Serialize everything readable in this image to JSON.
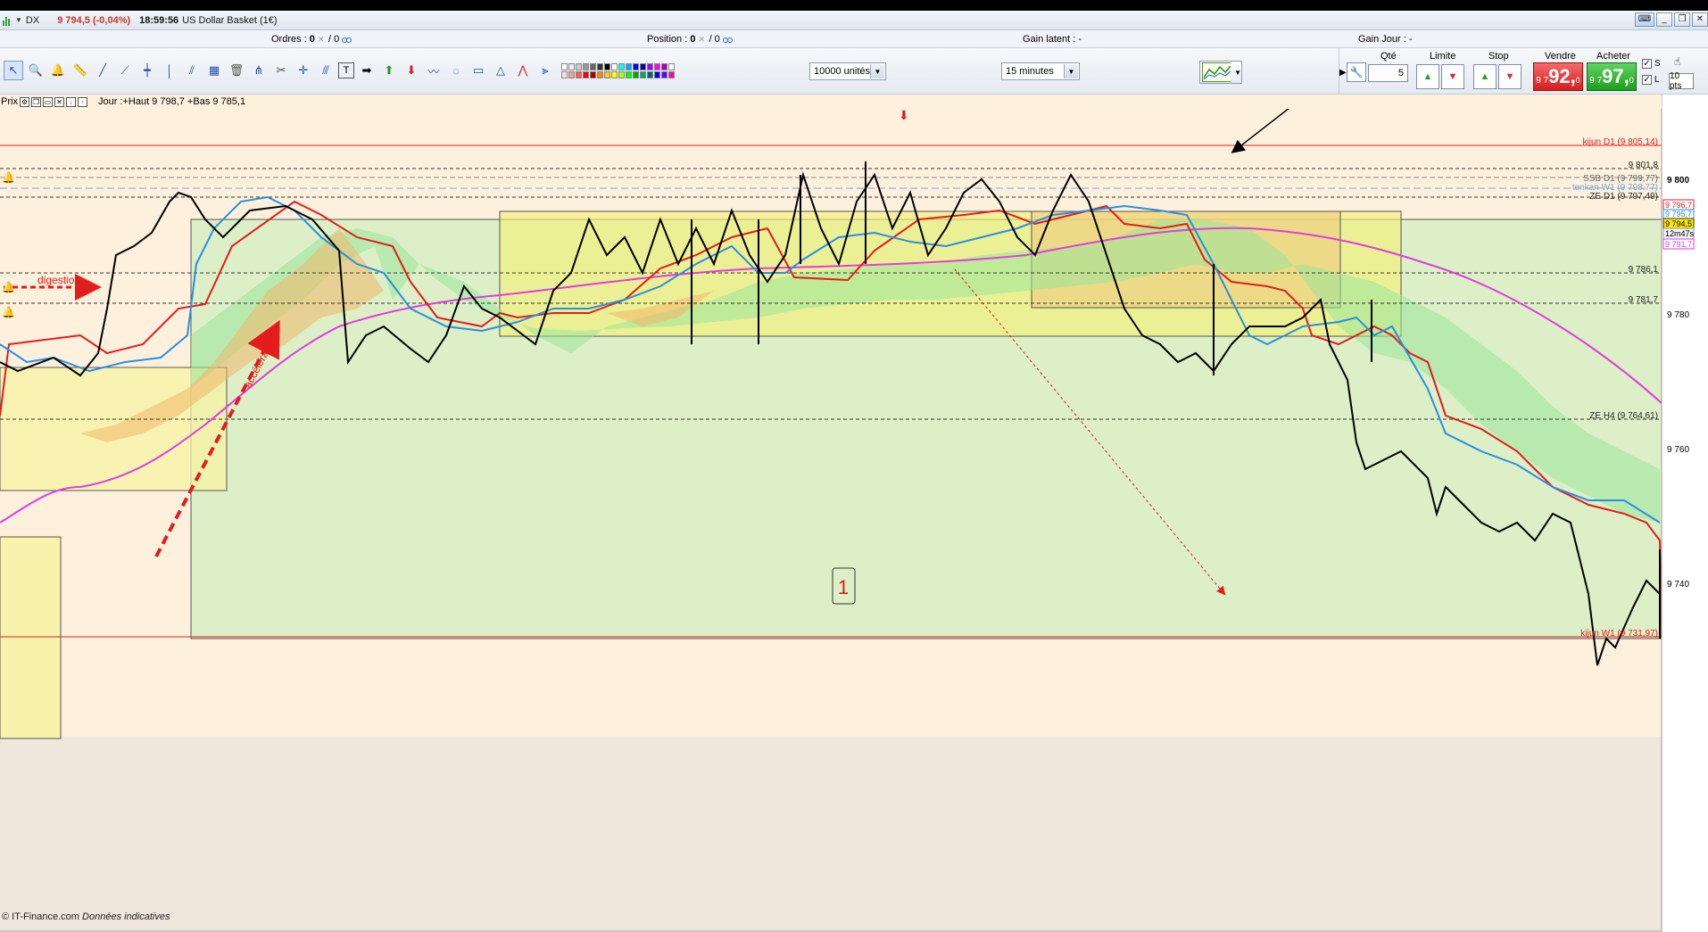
{
  "title_bar": {
    "symbol": "DX",
    "price_change": "9 794,5 (-0,04%)",
    "time": "18:59:56",
    "description": "US Dollar Basket (1€)"
  },
  "info_bar": {
    "ordres_label": "Ordres :",
    "ordres_value": "0",
    "ordres_slash": "/ 0",
    "position_label": "Position :",
    "position_value": "0",
    "position_slash": "/ 0",
    "gain_latent": "Gain latent : -",
    "gain_jour": "Gain Jour : -"
  },
  "toolbar": {
    "units_select": "10000 unités",
    "timeframe_select": "15 minutes",
    "tools": [
      "pointer-icon",
      "zoom-icon",
      "alarm-icon",
      "ruler-icon",
      "line-icon",
      "ray-icon",
      "horizontal-line-icon",
      "vertical-line-icon",
      "fibonacci-icon",
      "channel-icon",
      "trash-icon",
      "pitchfork-icon",
      "tools-icon",
      "crosshair-icon",
      "parallel-icon",
      "text-icon",
      "arrow-right-icon",
      "arrow-up-icon",
      "arrow-down-icon",
      "wave-icon",
      "lasso-icon",
      "rectangle-icon",
      "triangle-icon",
      "fan-icon",
      "gann-icon"
    ]
  },
  "order_panel": {
    "qte_label": "Qté",
    "qte_value": "5",
    "limite_label": "Limite",
    "stop_label": "Stop",
    "vendre_label": "Vendre",
    "acheter_label": "Acheter",
    "sell_small": "9 7",
    "sell_big": "92,",
    "sell_sup": "0",
    "buy_small": "9 7",
    "buy_big": "97,",
    "buy_sup": "0",
    "s_label": "S",
    "l_label": "L",
    "pts_value": "10 pts"
  },
  "chart_header": {
    "prix_label": "Prix",
    "day_info": "Jour :+Haut 9 798,7 +Bas 9 785,1"
  },
  "chart_labels": {
    "kijun_d1": "kijun D1 (9 805,14)",
    "level_9801": "9 801,8",
    "ssb_d1": "SSB D1 (9 799,77)",
    "tenkan_w1": "tenkan W1 (9 798,77)",
    "ze_d1": "ZE D1 (9 797,49)",
    "level_9786": "9 786,1",
    "level_9781": "9 781,7",
    "ze_h4": "ZE H4 (9 764,61)",
    "kijun_w1": "kijun W1 (9 731,97)",
    "digestion": "digestion",
    "acceleration": "accélération",
    "box_number": "1"
  },
  "price_axis": {
    "ticks": [
      "9 800",
      "9 780",
      "9 760",
      "9 740"
    ],
    "tag_red": "9 796,7",
    "tag_blue": "9 795,7",
    "tag_current": "9 794,5",
    "tag_timer": "12m47s",
    "tag_violet": "9 791,7"
  },
  "footer": {
    "source": "© IT-Finance.com",
    "note": "Données indicatives"
  },
  "colors": {
    "chart_bg": "#fdf1de",
    "green_zone": "#dcefc7",
    "yellow_zone": "#f7f3a3",
    "kijun_red": "#e31c1c",
    "tenkan_blue": "#2a8fe0",
    "ma_magenta": "#e23be2",
    "price_black": "#000000"
  }
}
